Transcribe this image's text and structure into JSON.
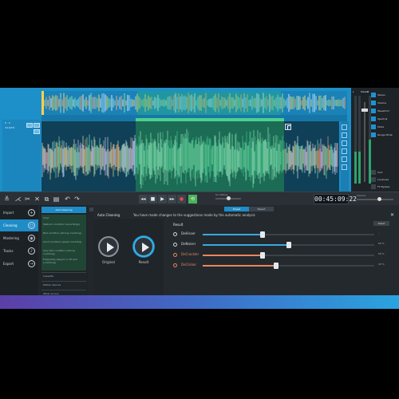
{
  "overview": {
    "selection_label": "3 4 5 6 7 8 9"
  },
  "wave": {
    "left_info": {
      "line1": "0 : 0",
      "line2": "44,1kHz"
    }
  },
  "mixer": {
    "label_l": "L",
    "label_master": "Master",
    "label_r": "R",
    "side_items": [
      "Stereo",
      "Volume",
      "Waveform",
      "Spectral",
      "Mode",
      "Range Mode"
    ],
    "bottom_items": [
      "Solo",
      "Loudness",
      "FX Bypass"
    ]
  },
  "toolbar": {
    "scrub_label": "Scrubbing",
    "time": "00:45:09:22",
    "volume_label": "Volume"
  },
  "nav": {
    "items": [
      {
        "label": "Import",
        "icon": "+"
      },
      {
        "label": "Cleaning",
        "icon": "○"
      },
      {
        "label": "Mastering",
        "icon": "◉"
      },
      {
        "label": "Tracks",
        "icon": "♪"
      },
      {
        "label": "Export",
        "icon": "→"
      }
    ]
  },
  "presets": {
    "header": "Auto Cleaning",
    "items": [
      "Vinyl",
      "Medium condition (recordings)",
      "Bad condition (strong crackling)",
      "Good condition (weak crackling)",
      "Very bad condition (strong crackling)",
      "Frequently played or 78 rpm (crackling)",
      "Cassette",
      "Mobile devices",
      "Other source"
    ]
  },
  "content": {
    "toggle": [
      "Preset",
      "Expert"
    ],
    "title": "Auto Cleaning",
    "message": "You have made changes to the suggestions made by the automatic analysis",
    "close": "✕",
    "original": "Original",
    "result": "Result",
    "result_header": "Result",
    "reset": "Reset",
    "rows": [
      {
        "name": "DeHisser",
        "color": "#cfd6dc",
        "value": 35,
        "pct": "–"
      },
      {
        "name": "DeNoiser",
        "color": "#cfd6dc",
        "value": 50,
        "pct": "60 %"
      },
      {
        "name": "DeCrackler",
        "color": "#e8875a",
        "value": 35,
        "pct": "50 %"
      },
      {
        "name": "DeClicker",
        "color": "#e8875a",
        "value": 43,
        "pct": "43 %"
      }
    ]
  },
  "colors": {
    "accent": "#1e8cc7",
    "waveform_bg": "#0f4058",
    "selection": "#1c6b55",
    "bottom_band": "#3f6cc6"
  }
}
